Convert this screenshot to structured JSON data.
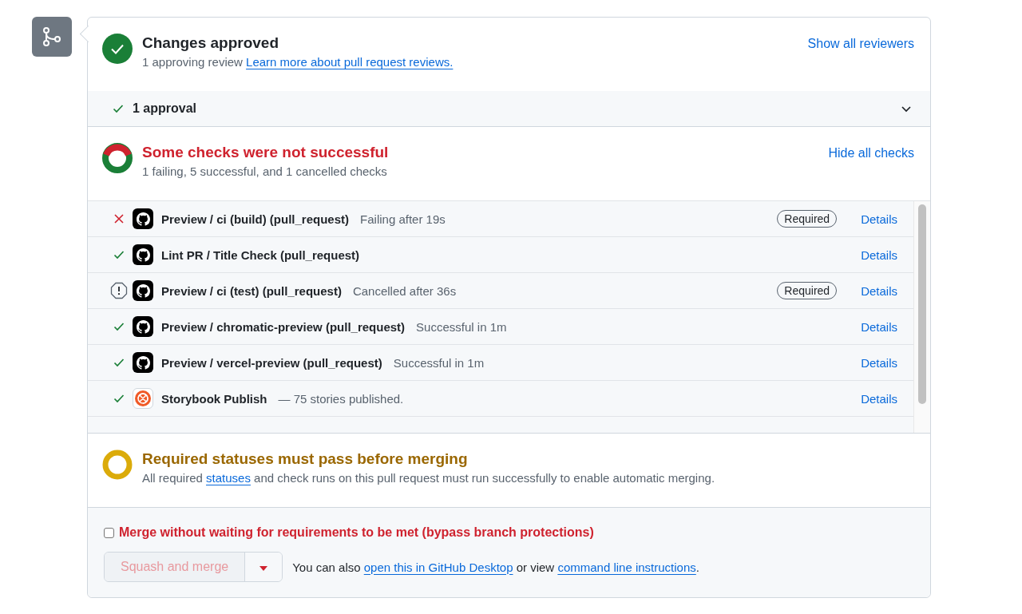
{
  "review": {
    "title": "Changes approved",
    "summary": "1 approving review",
    "link": "Learn more about pull request reviews.",
    "action": "Show all reviewers"
  },
  "approvals": {
    "label": "1 approval",
    "expanded": false
  },
  "checks": {
    "title": "Some checks were not successful",
    "summary": "1 failing, 5 successful, and 1 cancelled checks",
    "action": "Hide all checks",
    "items": [
      {
        "status": {
          "kind": "failure"
        },
        "logo": {
          "kind": "github"
        },
        "name": "Preview / ci (build) (pull_request)",
        "description": "Failing after 19s",
        "badge": "Required",
        "details": "Details"
      },
      {
        "status": {
          "kind": "success"
        },
        "logo": {
          "kind": "github"
        },
        "name": "Lint PR / Title Check (pull_request)",
        "details": "Details"
      },
      {
        "status": {
          "kind": "cancelled"
        },
        "logo": {
          "kind": "github"
        },
        "name": "Preview / ci (test) (pull_request)",
        "description": "Cancelled after 36s",
        "badge": "Required",
        "details": "Details"
      },
      {
        "status": {
          "kind": "success"
        },
        "logo": {
          "kind": "github"
        },
        "name": "Preview / chromatic-preview (pull_request)",
        "description": "Successful in 1m",
        "details": "Details"
      },
      {
        "status": {
          "kind": "success"
        },
        "logo": {
          "kind": "github"
        },
        "name": "Preview / vercel-preview (pull_request)",
        "description": "Successful in 1m",
        "details": "Details"
      },
      {
        "status": {
          "kind": "success"
        },
        "logo": {
          "kind": "storybook"
        },
        "name": "Storybook Publish",
        "description": "— 75 stories published.",
        "details": "Details"
      }
    ]
  },
  "requirement": {
    "title": "Required statuses must pass before merging",
    "text_before": "All required",
    "link": "statuses",
    "text_after": "and check runs on this pull request must run successfully to enable automatic merging."
  },
  "bypass": {
    "label": "Merge without waiting for requirements to be met (bypass branch protections)",
    "checked": false
  },
  "merge": {
    "button": "Squash and merge",
    "disabled": true,
    "hint_before": "You can also",
    "link_desktop": "open this in GitHub Desktop",
    "hint_middle": "or view",
    "link_cli": "command line instructions",
    "hint_end": "."
  }
}
